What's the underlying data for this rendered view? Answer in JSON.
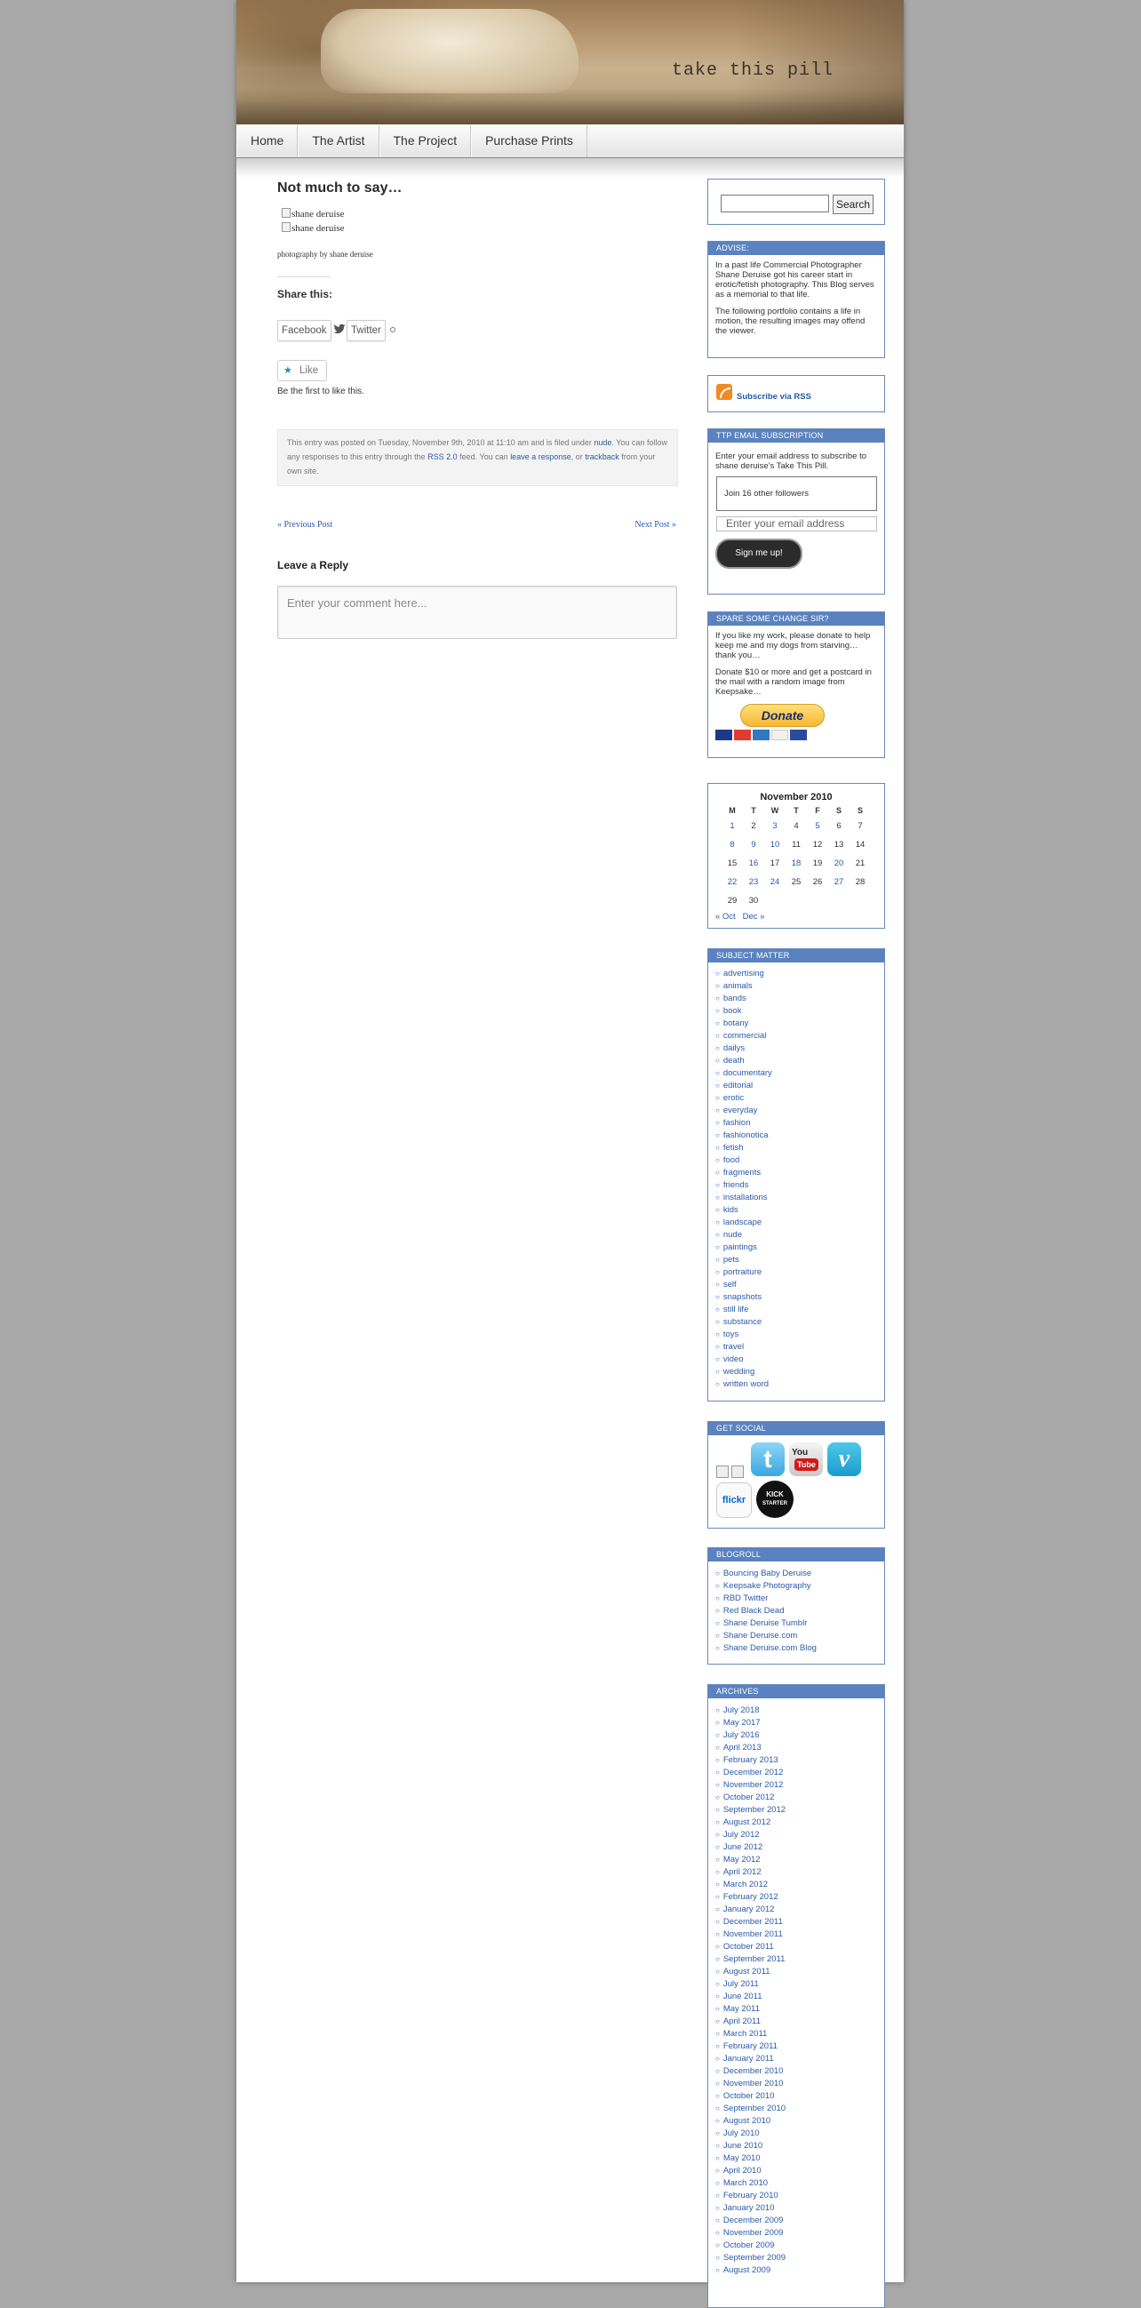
{
  "header": {
    "site_title": "take this pill"
  },
  "nav": {
    "items": [
      "Home",
      "The Artist",
      "The Project",
      "Purchase Prints"
    ]
  },
  "post": {
    "title": "Not much to say…",
    "image_alts": [
      "shane deruise",
      "shane deruise"
    ],
    "caption": "photography by shane deruise",
    "share_title": "Share this:",
    "share_buttons": [
      "Facebook",
      "Twitter"
    ],
    "like_label": "Like",
    "like_text": "Be the first to like this.",
    "meta": {
      "part1": "This entry was posted on Tuesday, November 9th, 2010 at 11:10 am and is filed under ",
      "category": "nude",
      "part2": ". You can follow any responses to this entry through the ",
      "rss": "RSS 2.0",
      "part3": " feed. You can ",
      "leave": "leave a response",
      "part4": ", or ",
      "trackback": "trackback",
      "part5": " from your own site."
    },
    "prev_post": "« Previous Post",
    "next_post": "Next Post »",
    "reply_title": "Leave a Reply",
    "comment_placeholder": "Enter your comment here..."
  },
  "sidebar": {
    "search": {
      "button": "Search",
      "value": ""
    },
    "advise": {
      "title": "ADVISE:",
      "p1": "In a past life Commercial Photographer Shane Deruise got his career start in erotic/fetish photography. This Blog serves as a memorial to that life.",
      "p2": "The following portfolio contains a life in motion, the resulting images may offend the viewer."
    },
    "rss": {
      "link": "Subscribe via RSS"
    },
    "email": {
      "title": "TTP EMAIL SUBSCRIPTION",
      "text": "Enter your email address to subscribe to shane deruise's Take This Pill.",
      "followers": "Join 16 other followers",
      "placeholder": "Enter your email address",
      "button": "Sign me up!"
    },
    "donate": {
      "title": "SPARE SOME CHANGE SIR?",
      "p1": "If you like my work, please donate to help keep me and my dogs from starving… thank you…",
      "p2": "Donate $10 or more and get a postcard in the mail with a random image from Keepsake…",
      "button": "Donate"
    },
    "calendar": {
      "caption": "November 2010",
      "headers": [
        "M",
        "T",
        "W",
        "T",
        "F",
        "S",
        "S"
      ],
      "weeks": [
        [
          "1",
          "2",
          "3",
          "4",
          "5",
          "6",
          "7"
        ],
        [
          "8",
          "9",
          "10",
          "11",
          "12",
          "13",
          "14"
        ],
        [
          "15",
          "16",
          "17",
          "18",
          "19",
          "20",
          "21"
        ],
        [
          "22",
          "23",
          "24",
          "25",
          "26",
          "27",
          "28"
        ],
        [
          "29",
          "30",
          "",
          "",
          "",
          "",
          ""
        ]
      ],
      "linked_days": [
        "1",
        "3",
        "5",
        "8",
        "9",
        "10",
        "16",
        "18",
        "20",
        "22",
        "23",
        "24",
        "27"
      ],
      "prev": "« Oct",
      "next": "Dec »"
    },
    "subjects": {
      "title": "SUBJECT MATTER",
      "items": [
        "advertising",
        "animals",
        "bands",
        "book",
        "botany",
        "commercial",
        "dailys",
        "death",
        "documentary",
        "editorial",
        "erotic",
        "everyday",
        "fashion",
        "fashionotica",
        "fetish",
        "food",
        "fragments",
        "friends",
        "installations",
        "kids",
        "landscape",
        "nude",
        "paintings",
        "pets",
        "portraiture",
        "self",
        "snapshots",
        "still life",
        "substance",
        "toys",
        "travel",
        "video",
        "wedding",
        "written word"
      ]
    },
    "social": {
      "title": "GET SOCIAL",
      "twitter": "t",
      "youtube_you": "You",
      "youtube_tube": "Tube",
      "vimeo": "v",
      "flickr": "flickr",
      "kickstarter": [
        "KICK",
        "STARTER"
      ]
    },
    "blogroll": {
      "title": "BLOGROLL",
      "items": [
        "Bouncing Baby Deruise",
        "Keepsake Photography",
        "RBD Twitter",
        "Red Black Dead",
        "Shane Deruise Tumblr",
        "Shane Deruise.com",
        "Shane Deruise.com Blog"
      ]
    },
    "archives": {
      "title": "ARCHIVES",
      "items": [
        "July 2018",
        "May 2017",
        "July 2016",
        "April 2013",
        "February 2013",
        "December 2012",
        "November 2012",
        "October 2012",
        "September 2012",
        "August 2012",
        "July 2012",
        "June 2012",
        "May 2012",
        "April 2012",
        "March 2012",
        "February 2012",
        "January 2012",
        "December 2011",
        "November 2011",
        "October 2011",
        "September 2011",
        "August 2011",
        "July 2011",
        "June 2011",
        "May 2011",
        "April 2011",
        "March 2011",
        "February 2011",
        "January 2011",
        "December 2010",
        "November 2010",
        "October 2010",
        "September 2010",
        "August 2010",
        "July 2010",
        "June 2010",
        "May 2010",
        "April 2010",
        "March 2010",
        "February 2010",
        "January 2010",
        "December 2009",
        "November 2009",
        "October 2009",
        "September 2009",
        "August 2009"
      ]
    }
  }
}
